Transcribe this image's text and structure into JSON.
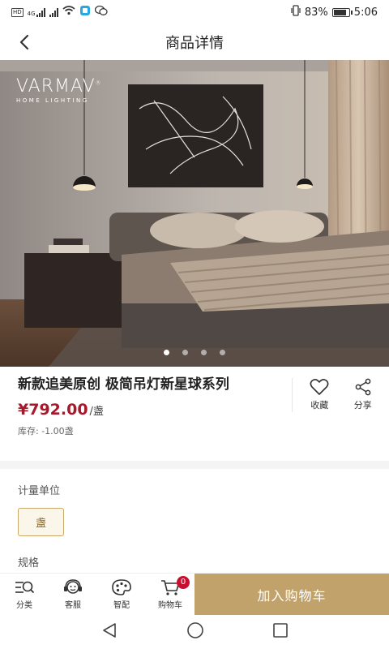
{
  "status_bar": {
    "network_badge": "HD",
    "signal1_label": "4G",
    "battery_percent": "83%",
    "time": "5:06",
    "battery_level": 0.83
  },
  "header": {
    "title": "商品详情"
  },
  "gallery": {
    "brand_name": "VARMAV",
    "brand_mark": "®",
    "brand_subtitle": "HOME LIGHTING",
    "slide_count": 4,
    "active_slide": 1
  },
  "product": {
    "name": "新款追美原创 极简吊灯新星球系列",
    "price": "¥792.00",
    "unit": "/盏",
    "stock": "库存: -1.00盏",
    "favorite_label": "收藏",
    "share_label": "分享"
  },
  "spec": {
    "measure_unit_label": "计量单位",
    "measure_unit_option": "盏",
    "spec_label": "规格"
  },
  "bottom_bar": {
    "category_label": "分类",
    "service_label": "客服",
    "match_label": "智配",
    "cart_label": "购物车",
    "cart_count": "0",
    "add_to_cart_label": "加入购物车"
  },
  "colors": {
    "price": "#a8182a",
    "accent_gold": "#c1a26b",
    "badge_red": "#c8102e"
  }
}
